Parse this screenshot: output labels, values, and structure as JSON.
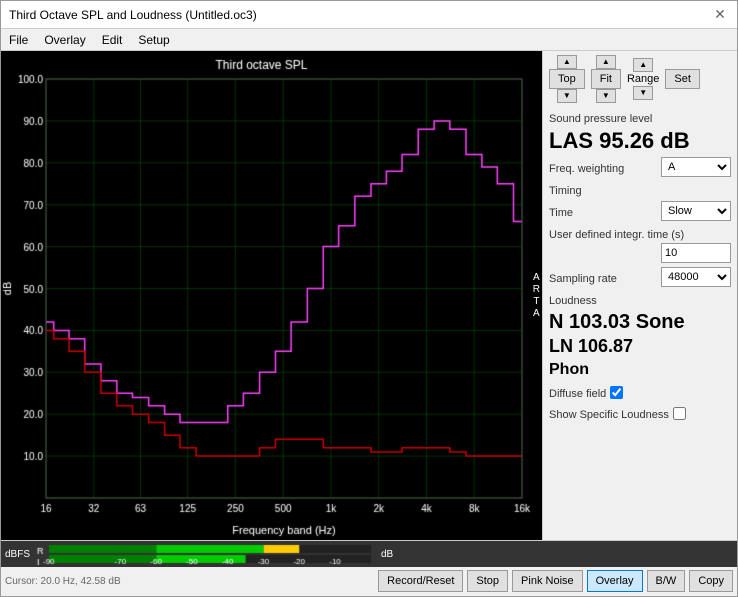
{
  "window": {
    "title": "Third Octave SPL and Loudness (Untitled.oc3)"
  },
  "menu": {
    "items": [
      "File",
      "Overlay",
      "Edit",
      "Setup"
    ]
  },
  "nav": {
    "top_label": "Top",
    "fit_label": "Fit",
    "range_label": "Range",
    "set_label": "Set"
  },
  "chart": {
    "title": "Third octave SPL",
    "x_labels": [
      "16",
      "32",
      "63",
      "125",
      "250",
      "500",
      "1k",
      "2k",
      "4k",
      "8k",
      "16k"
    ],
    "y_labels": [
      "100.0",
      "90.0",
      "80.0",
      "70.0",
      "60.0",
      "50.0",
      "40.0",
      "30.0",
      "20.0",
      "10.0"
    ],
    "db_label": "dB",
    "freq_band_label": "Frequency band (Hz)",
    "cursor_info": "Cursor:  20.0 Hz, 42.58 dB",
    "arta_label": "A\nR\nT\nA"
  },
  "spl": {
    "section_label": "Sound pressure level",
    "value": "LAS 95.26 dB",
    "freq_weighting_label": "Freq. weighting",
    "freq_weighting_value": "A"
  },
  "timing": {
    "section_label": "Timing",
    "time_label": "Time",
    "time_value": "Slow",
    "user_defined_label": "User defined integr. time (s)",
    "user_defined_value": "10",
    "sampling_rate_label": "Sampling rate",
    "sampling_rate_value": "48000"
  },
  "loudness": {
    "section_label": "Loudness",
    "n_value": "N 103.03 Sone",
    "ln_value": "LN 106.87",
    "phon_label": "Phon",
    "diffuse_field_label": "Diffuse field",
    "diffuse_field_checked": true,
    "show_specific_label": "Show Specific Loudness",
    "show_specific_checked": false
  },
  "dbfs": {
    "label": "dBFS",
    "ticks": [
      "-90",
      "-70",
      "-60",
      "-50",
      "-40",
      "-30",
      "-20",
      "-10",
      "dB"
    ],
    "r_label": "R",
    "i_label": "I"
  },
  "buttons": {
    "record_reset": "Record/Reset",
    "stop": "Stop",
    "pink_noise": "Pink Noise",
    "overlay": "Overlay",
    "bw": "B/W",
    "copy": "Copy"
  },
  "colors": {
    "accent": "#0078d7",
    "chart_bg": "#000000",
    "grid": "#006600",
    "pink_curve": "#ff44ff",
    "red_curve": "#cc0000"
  }
}
